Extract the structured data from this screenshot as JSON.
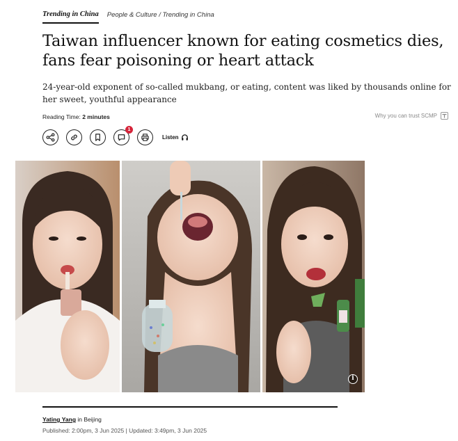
{
  "nav": {
    "topic": "Trending in China",
    "breadcrumb": "People & Culture / Trending in China"
  },
  "article": {
    "headline": "Taiwan influencer known for eating cosmetics dies, fans fear poisoning or heart attack",
    "subhead": "24-year-old exponent of so-called mukbang, or eating, content was liked by thousands online for her sweet, youthful appearance",
    "reading_label": "Reading Time:",
    "reading_value": "2 minutes",
    "trust_label": "Why you can trust SCMP",
    "listen_label": "Listen",
    "comment_count": "1",
    "author": "Yating Yang",
    "location": "in Beijing",
    "published": "Published: 2:00pm, 3 Jun 2025 | Updated: 3:49pm, 3 Jun 2025"
  },
  "toolbar": {
    "icons": [
      "share-icon",
      "link-icon",
      "bookmark-icon",
      "comment-icon",
      "print-icon",
      "headphones-icon"
    ]
  },
  "colors": {
    "badge": "#d6243a",
    "text": "#111111"
  }
}
